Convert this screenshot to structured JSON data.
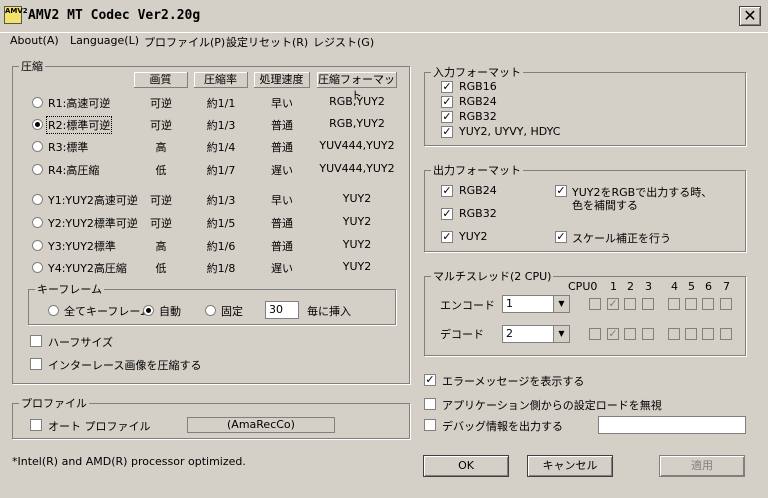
{
  "window": {
    "title": "AMV2 MT Codec Ver2.20g",
    "icon_text": "AMV2"
  },
  "menu": [
    "About(A)",
    "Language(L)",
    "プロファイル(P)",
    "設定リセット(R)",
    "レジスト(G)"
  ],
  "compression": {
    "legend": "圧縮",
    "headers": {
      "quality": "画質",
      "ratio": "圧縮率",
      "speed": "処理速度",
      "format": "圧縮フォーマット"
    },
    "rows": [
      {
        "label": "R1:高速可逆",
        "quality": "可逆",
        "ratio": "約1/1",
        "speed": "早い",
        "format": "RGB,YUY2",
        "selected": false
      },
      {
        "label": "R2:標準可逆",
        "quality": "可逆",
        "ratio": "約1/3",
        "speed": "普通",
        "format": "RGB,YUY2",
        "selected": true
      },
      {
        "label": "R3:標準",
        "quality": "高",
        "ratio": "約1/4",
        "speed": "普通",
        "format": "YUV444,YUY2",
        "selected": false
      },
      {
        "label": "R4:高圧縮",
        "quality": "低",
        "ratio": "約1/7",
        "speed": "遅い",
        "format": "YUV444,YUY2",
        "selected": false
      },
      {
        "label": "Y1:YUY2高速可逆",
        "quality": "可逆",
        "ratio": "約1/3",
        "speed": "早い",
        "format": "YUY2",
        "selected": false
      },
      {
        "label": "Y2:YUY2標準可逆",
        "quality": "可逆",
        "ratio": "約1/5",
        "speed": "普通",
        "format": "YUY2",
        "selected": false
      },
      {
        "label": "Y3:YUY2標準",
        "quality": "高",
        "ratio": "約1/6",
        "speed": "普通",
        "format": "YUY2",
        "selected": false
      },
      {
        "label": "Y4:YUY2高圧縮",
        "quality": "低",
        "ratio": "約1/8",
        "speed": "遅い",
        "format": "YUY2",
        "selected": false
      }
    ]
  },
  "keyframe": {
    "legend": "キーフレーム",
    "all": "全てキーフレーム",
    "auto": "自動",
    "fixed": "固定",
    "interval_value": "30",
    "interval_suffix": "毎に挿入",
    "selected": "auto"
  },
  "options": {
    "half_size": "ハーフサイズ",
    "interlace": "インターレース画像を圧縮する"
  },
  "profile": {
    "legend": "プロファイル",
    "auto_profile": "オート プロファイル",
    "name": "(AmaRecCo)"
  },
  "note": "*Intel(R) and AMD(R) processor optimized.",
  "input_format": {
    "legend": "入力フォーマット",
    "items": [
      "RGB16",
      "RGB24",
      "RGB32",
      "YUY2, UYVY, HDYC"
    ],
    "checked": [
      true,
      true,
      true,
      true
    ]
  },
  "output_format": {
    "legend": "出力フォーマット",
    "rgb24": "RGB24",
    "rgb32": "RGB32",
    "yuy2": "YUY2",
    "yuy2_rgb_line1": "YUY2をRGBで出力する時、",
    "yuy2_rgb_line2": "色を補間する",
    "scale": "スケール補正を行う"
  },
  "multithread": {
    "legend": "マルチスレッド(2 CPU)",
    "cpu_labels": [
      "CPU0",
      "1",
      "2",
      "3",
      "4",
      "5",
      "6",
      "7"
    ],
    "encode_label": "エンコード",
    "decode_label": "デコード",
    "encode_value": "1",
    "decode_value": "2"
  },
  "misc": {
    "show_errors": "エラーメッセージを表示する",
    "ignore_app": "アプリケーション側からの設定ロードを無視",
    "debug": "デバッグ情報を出力する"
  },
  "buttons": {
    "ok": "OK",
    "cancel": "キャンセル",
    "apply": "適用"
  }
}
